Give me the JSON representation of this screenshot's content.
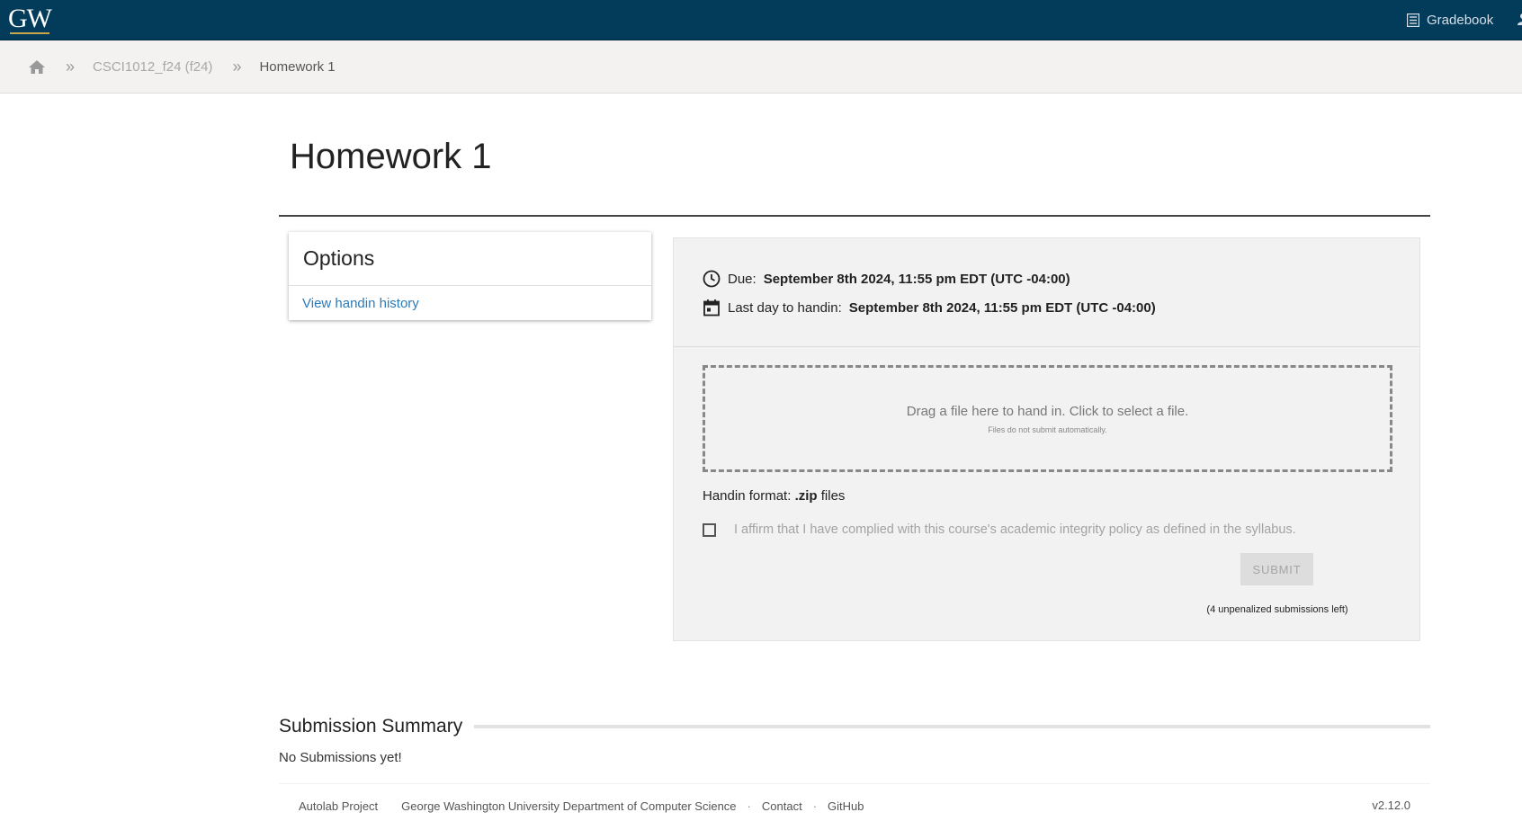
{
  "header": {
    "logo_text": "GW",
    "gradebook_label": "Gradebook",
    "colors": {
      "bar": "#033c5a",
      "logo_underline": "#c9a64b"
    }
  },
  "breadcrumb": {
    "course": "CSCI1012_f24 (f24)",
    "current": "Homework 1"
  },
  "page": {
    "title": "Homework 1"
  },
  "options": {
    "title": "Options",
    "history_link": "View handin history"
  },
  "handin": {
    "due_label": "Due:",
    "due_value": "September 8th 2024, 11:55 pm EDT (UTC -04:00)",
    "last_day_label": "Last day to handin:",
    "last_day_value": "September 8th 2024, 11:55 pm EDT (UTC -04:00)",
    "dropzone_text": "Drag a file here to hand in. Click to select a file.",
    "dropzone_subtext": "Files do not submit automatically.",
    "format_label": "Handin format:",
    "format_value": ".zip",
    "format_suffix": "files",
    "affirm_text": "I affirm that I have complied with this course's academic integrity policy as defined in the syllabus.",
    "submit_label": "SUBMIT",
    "submissions_left": "(4 unpenalized submissions left)"
  },
  "summary": {
    "title": "Submission Summary",
    "empty_text": "No Submissions yet!"
  },
  "footer": {
    "project": "Autolab Project",
    "department": "George Washington University Department of Computer Science",
    "separator": "·",
    "contact": "Contact",
    "github": "GitHub",
    "version": "v2.12.0"
  }
}
